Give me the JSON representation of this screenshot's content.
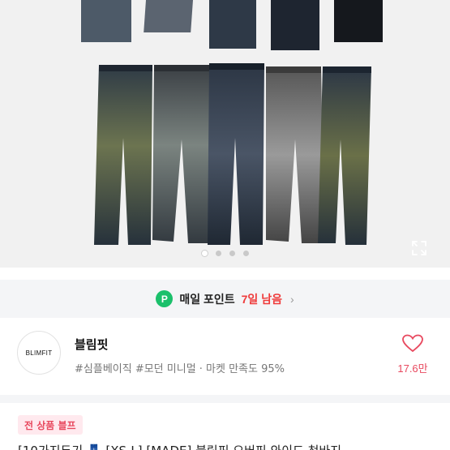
{
  "gallery": {
    "slide_count": 4,
    "active_slide": 1
  },
  "points": {
    "badge": "P",
    "label": "매일 포인트",
    "days": "7일 남음"
  },
  "shop": {
    "avatar_text": "BLIMFIT",
    "name": "블림핏",
    "tags": "#심플베이직 #모던 미니멀 · 마켓 만족도 95%",
    "likes": "17.6만"
  },
  "sale_badge": "전 상품 블프",
  "product_title": "[10가지두기 👖 [XS-L] [MADE] 블림핏 오버핏 와이드 청바지"
}
